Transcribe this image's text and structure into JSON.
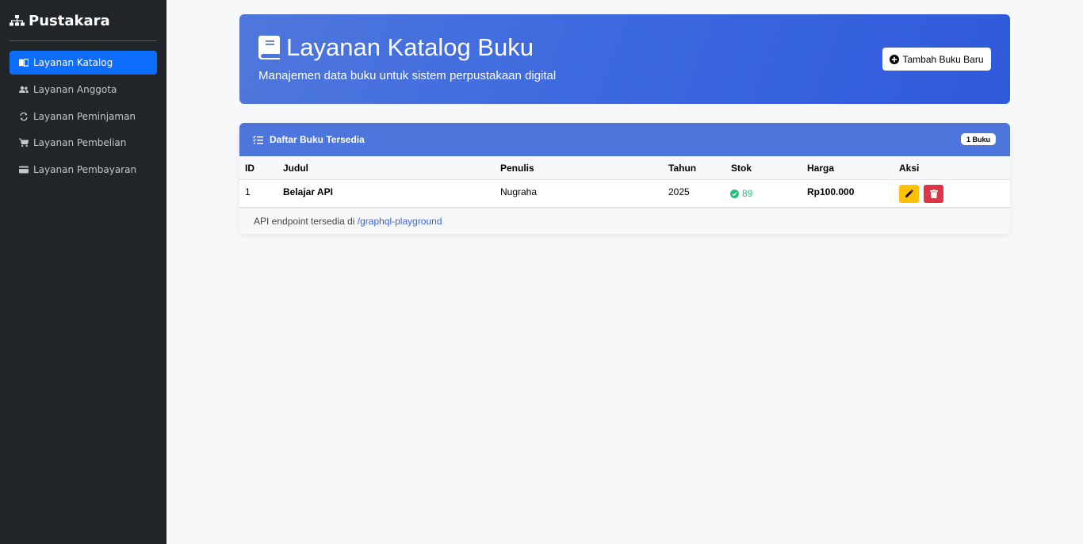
{
  "sidebar": {
    "brand": "Pustakara",
    "items": [
      {
        "label": "Layanan Katalog",
        "icon": "book-open-icon",
        "active": true
      },
      {
        "label": "Layanan Anggota",
        "icon": "users-icon"
      },
      {
        "label": "Layanan Peminjaman",
        "icon": "sync-icon"
      },
      {
        "label": "Layanan Pembelian",
        "icon": "cart-icon"
      },
      {
        "label": "Layanan Pembayaran",
        "icon": "credit-card-icon"
      }
    ]
  },
  "hero": {
    "title": "Layanan Katalog Buku",
    "subtitle": "Manajemen data buku untuk sistem perpustakaan digital",
    "add_button": "Tambah Buku Baru"
  },
  "table_card": {
    "title": "Daftar Buku Tersedia",
    "count_badge": "1 Buku",
    "columns": [
      "ID",
      "Judul",
      "Penulis",
      "Tahun",
      "Stok",
      "Harga",
      "Aksi"
    ],
    "rows": [
      {
        "id": "1",
        "title": "Belajar API",
        "author": "Nugraha",
        "year": "2025",
        "stock": "89",
        "price": "Rp100.000"
      }
    ],
    "footer_text": "API endpoint tersedia di",
    "footer_link": "/graphql-playground"
  },
  "colors": {
    "sidebar_bg": "#212529",
    "active_item": "#0d6efd",
    "hero_gradient_start": "#4f77dc",
    "hero_gradient_end": "#2f59da",
    "card_header": "#4d76dd",
    "stock_ok": "#20c27a",
    "edit_button": "#ffc107",
    "delete_button": "#dc3545"
  }
}
